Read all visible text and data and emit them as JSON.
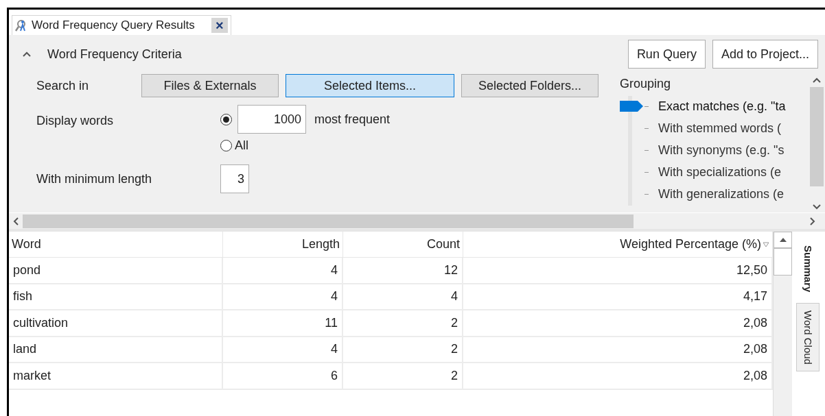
{
  "tab": {
    "title": "Word Frequency Query Results",
    "close": "×"
  },
  "criteria": {
    "title": "Word Frequency Criteria",
    "expanded": true,
    "actions": [
      "Run Query",
      "Add to Project..."
    ],
    "search_in": {
      "label": "Search in",
      "options": [
        {
          "label": "Files & Externals",
          "selected": false
        },
        {
          "label": "Selected Items...",
          "selected": true
        },
        {
          "label": "Selected Folders...",
          "selected": false
        }
      ]
    },
    "display_words": {
      "label": "Display words",
      "options": [
        {
          "kind": "count",
          "selected": true,
          "value": "1000",
          "suffix": "most frequent"
        },
        {
          "kind": "all",
          "selected": false,
          "label": "All"
        }
      ]
    },
    "min_length": {
      "label": "With minimum length",
      "value": "3"
    },
    "grouping": {
      "label": "Grouping",
      "options": [
        {
          "label": "Exact matches (e.g. \"ta",
          "selected": true
        },
        {
          "label": "With stemmed words (",
          "selected": false
        },
        {
          "label": "With synonyms (e.g. \"s",
          "selected": false
        },
        {
          "label": "With specializations (e",
          "selected": false
        },
        {
          "label": "With generalizations (e",
          "selected": false
        }
      ]
    }
  },
  "table": {
    "columns": [
      {
        "label": "Word",
        "sorted": false
      },
      {
        "label": "Length",
        "sorted": false
      },
      {
        "label": "Count",
        "sorted": false
      },
      {
        "label": "Weighted Percentage (%)",
        "sorted": true
      }
    ],
    "rows": [
      [
        "pond",
        "4",
        "12",
        "12,50"
      ],
      [
        "fish",
        "4",
        "4",
        "4,17"
      ],
      [
        "cultivation",
        "11",
        "2",
        "2,08"
      ],
      [
        "land",
        "4",
        "2",
        "2,08"
      ],
      [
        "market",
        "6",
        "2",
        "2,08"
      ]
    ]
  },
  "side_tabs": [
    {
      "label": "Summary",
      "selected": true
    },
    {
      "label": "Word Cloud",
      "selected": false
    }
  ]
}
